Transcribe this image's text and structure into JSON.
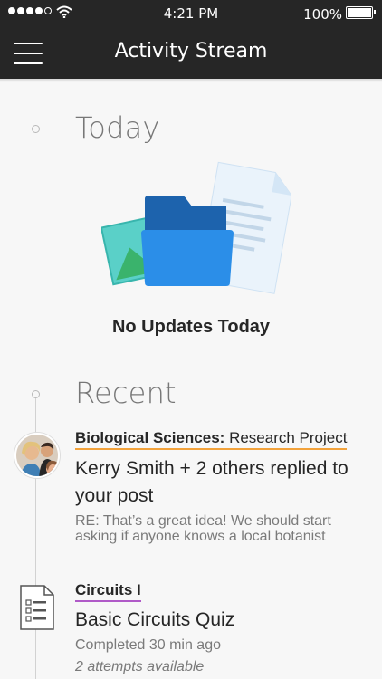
{
  "status_bar": {
    "time": "4:21 PM",
    "battery": "100%"
  },
  "nav": {
    "title": "Activity Stream",
    "menu_icon": "hamburger-menu-icon"
  },
  "today": {
    "heading": "Today",
    "empty_message": "No Updates Today",
    "illustration_icon": "folder-documents-illustration"
  },
  "recent": {
    "heading": "Recent",
    "items": [
      {
        "course": "Biological Sciences:",
        "context": "Research Project",
        "headline": "Kerry Smith + 2 others replied to your post",
        "detail": "RE: That’s a great idea! We should start asking if anyone knows a local botanist",
        "icon": "group-avatar",
        "accent": "#f2a23b"
      },
      {
        "course": "Circuits I",
        "headline": "Basic Circuits Quiz",
        "detail": "Completed 30 min ago",
        "note": "2 attempts available",
        "icon": "quiz-document-icon",
        "accent": "#b05ac8"
      }
    ]
  },
  "colors": {
    "header_bg": "#262626",
    "page_bg": "#f7f7f7",
    "folder_blue": "#2b8ee8"
  }
}
